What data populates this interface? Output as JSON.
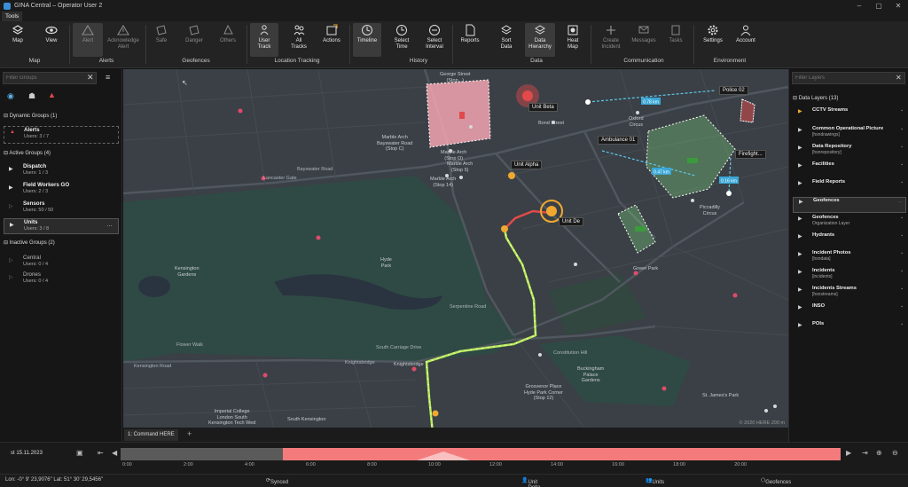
{
  "window": {
    "title": "GINA Central – Operator User 2",
    "tab": "Tools"
  },
  "ribbon": {
    "buttons": {
      "map": "Map",
      "view": "View",
      "alert": "Alert",
      "ack": "Acknowledge\nAlert",
      "safe": "Safe",
      "danger": "Danger",
      "others": "Others",
      "user_track": "User\nTrack",
      "all_tracks": "All\nTracks",
      "actions": "Actions",
      "timeline": "Timeline",
      "select_time": "Select\nTime",
      "select_interval": "Select\nInterval",
      "reports": "Reports",
      "sort_data": "Sort\nData",
      "data_hierarchy": "Data\nHierarchy",
      "heat_map": "Heat\nMap",
      "create_incident": "Create\nIncident",
      "messages": "Messages",
      "tasks": "Tasks",
      "settings": "Settings",
      "account": "Account"
    },
    "groups": {
      "map": "Map",
      "alerts": "Alerts",
      "geofences": "Geofences",
      "location": "Location Tracking",
      "history": "History",
      "data": "Data",
      "communication": "Communication",
      "environment": "Environment"
    }
  },
  "left_panel": {
    "filter_placeholder": "Filter Groups",
    "dynamic_groups": "Dynamic Groups (1)",
    "active_groups": "Active Groups (4)",
    "inactive_groups": "Inactive Groups (2)",
    "items": [
      {
        "name": "Alerts",
        "users": "Users: 3 / 7"
      },
      {
        "name": "Dispatch",
        "users": "Users: 1 / 3"
      },
      {
        "name": "Field Workers GO",
        "users": "Users: 2 / 3"
      },
      {
        "name": "Sensors",
        "users": "Users: 50 / 50"
      },
      {
        "name": "Units",
        "users": "Users: 3 / 8"
      },
      {
        "name": "Central",
        "users": "Users: 0 / 4"
      },
      {
        "name": "Drones",
        "users": "Users: 0 / 4"
      }
    ]
  },
  "map": {
    "tags": {
      "unit_beta": "Unit Beta",
      "unit_alpha": "Unit Alpha",
      "unit_delta": "Unit De",
      "police": "Police 02",
      "ambulance": "Ambulance 01",
      "fire": "Firefight..."
    },
    "distances": [
      "0.78 km",
      "0.47 km",
      "0.16 km"
    ],
    "places": {
      "george_st": "George Street\n(Stop...)",
      "marble_arch_big": "Marble Arch\nBayswater Road\n(Stop C)",
      "marble_arch": "Marble Arch\n(Stop O)",
      "marble_arch_s14": "Marble Arch\n(Stop 14)",
      "marble_arch_s5": "Marble Arch\n(Stop 5)",
      "bond_st": "Bond Street",
      "oxford_circus": "Oxford\nCircus",
      "piccadilly": "Piccadilly\nCircus",
      "green_park": "Green Park",
      "hyde_park": "Hyde\nPark",
      "kensington_gardens": "Kensington\nGardens",
      "grosvenor": "Grosvenor Place\nHyde Park Corner\n(Stop 12)",
      "knightsbridge": "Knightsbridge",
      "st_james": "St. James's Park",
      "buckingham": "Buckingham\nPalace\nGardens",
      "imperial": "Imperial College\nLondon South\nKensington Tech Wed",
      "south_kensington": "South Kensington"
    },
    "roads": {
      "bayswater": "Bayswater Road",
      "lancaster": "Lancaster Gate",
      "kensington_road": "Kensington Road",
      "knightsbridge_road": "Knightsbridge",
      "serpentine": "Serpentine Road",
      "constitution": "Constitution Hill",
      "south_carriage": "South Carriage Drive",
      "flower_walk": "Flower Walk"
    },
    "copyright": "© 2020 HERE  200 m",
    "tab": "1: Command HERE"
  },
  "right_panel": {
    "filter_placeholder": "Filter Layers",
    "header": "Data Layers (13)",
    "layers": [
      {
        "name": "CCTV Streams",
        "sub": ""
      },
      {
        "name": "Common Operational Picture",
        "sub": "[hsndrawings]"
      },
      {
        "name": "Data Repository",
        "sub": "[hsnrepository]"
      },
      {
        "name": "Facilities",
        "sub": ""
      },
      {
        "name": "Field Reports",
        "sub": ""
      },
      {
        "name": "Geofences",
        "sub": ""
      },
      {
        "name": "Geofences",
        "sub": "Organization Layer"
      },
      {
        "name": "Hydrants",
        "sub": ""
      },
      {
        "name": "Incident Photos",
        "sub": "[hsndata]"
      },
      {
        "name": "Incidents",
        "sub": "[incidents]"
      },
      {
        "name": "Incidents Streams",
        "sub": "[hsnstreams]"
      },
      {
        "name": "INSO",
        "sub": ""
      },
      {
        "name": "POIs",
        "sub": ""
      }
    ]
  },
  "timeline": {
    "date": "st 15.11.2023",
    "ticks": [
      "0:00",
      "2:00",
      "4:00",
      "6:00",
      "8:00",
      "10:00",
      "12:00",
      "14:00",
      "16:00",
      "18:00",
      "20:00"
    ],
    "selection_start_fraction": 0.225,
    "selection_end_fraction": 1.0
  },
  "status": {
    "coords": "Lon: -0° 9' 23,9076\"  Lat: 51° 30' 29,5456\"",
    "sync": "Synced",
    "unit": "Unit Delta",
    "units": "Units",
    "geofences": "Geofences"
  }
}
